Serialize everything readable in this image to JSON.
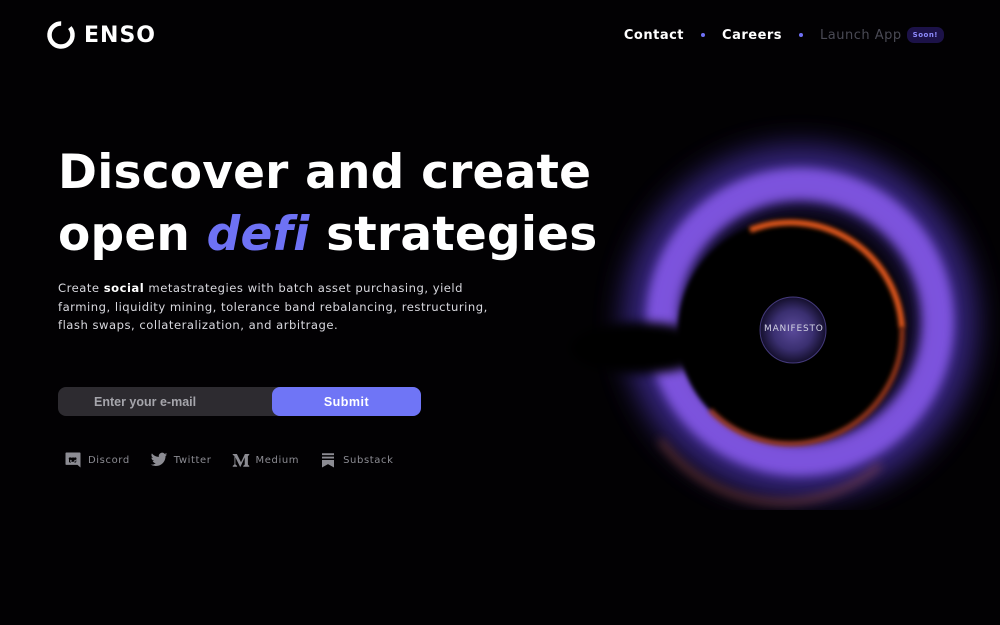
{
  "header": {
    "logo_text": "ENSO",
    "nav": [
      {
        "label": "Contact"
      },
      {
        "label": "Careers"
      },
      {
        "label": "Launch App",
        "badge": "Soon!"
      }
    ]
  },
  "hero": {
    "headline_line1": "Discover and create",
    "headline_line2_pre": "open ",
    "headline_accent": "defi",
    "headline_line2_post": " strategies",
    "sub_pre": "Create ",
    "sub_bold": "social",
    "sub_post": " metastrategies with batch asset purchasing, yield farming, liquidity mining, tolerance band rebalancing, restructuring, flash swaps, collateralization, and arbitrage."
  },
  "form": {
    "email_placeholder": "Enter your e-mail",
    "email_value": "",
    "submit_label": "Submit"
  },
  "socials": [
    {
      "label": "Discord",
      "icon": "discord-icon"
    },
    {
      "label": "Twitter",
      "icon": "twitter-icon"
    },
    {
      "label": "Medium",
      "icon": "medium-icon"
    },
    {
      "label": "Substack",
      "icon": "substack-icon"
    }
  ],
  "visual": {
    "manifesto_label": "MANIFESTO"
  },
  "colors": {
    "background": "#020103",
    "accent": "#6f75f6",
    "ring_purple": "#7a55e8",
    "ring_orange": "#e2541a"
  }
}
